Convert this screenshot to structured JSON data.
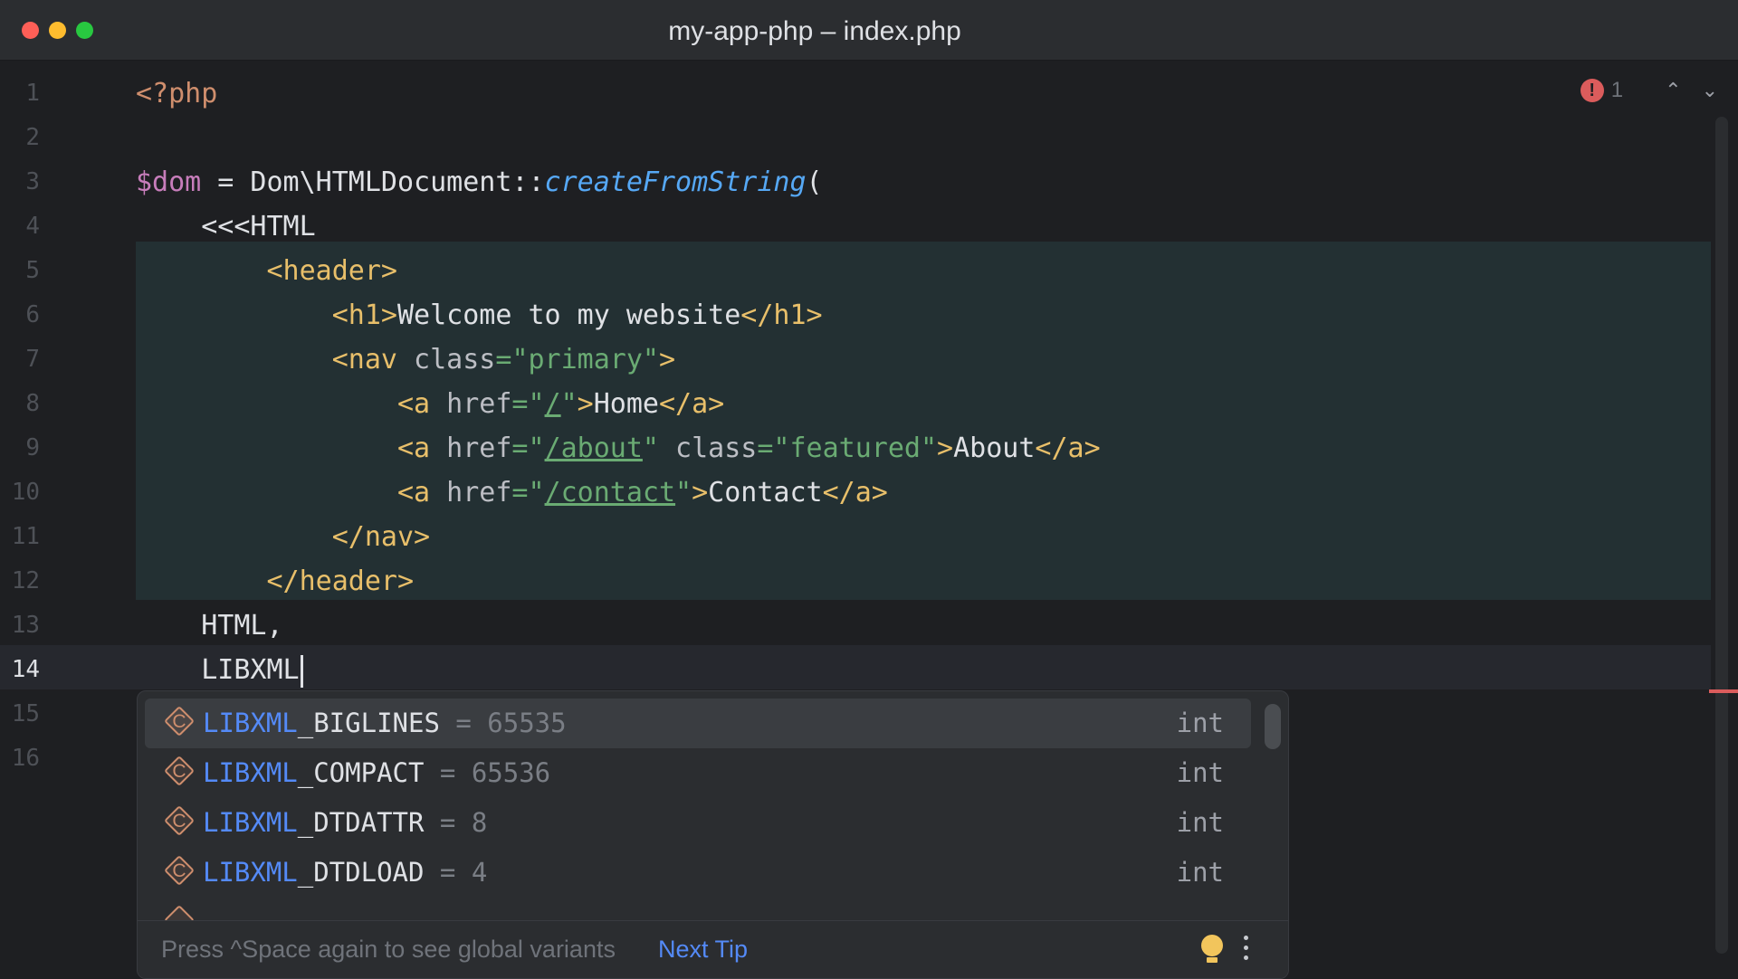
{
  "window": {
    "title": "my-app-php – index.php"
  },
  "inspections": {
    "error_count": "1",
    "error_glyph": "!",
    "up_glyph": "⌃",
    "down_glyph": "⌄"
  },
  "lines": [
    {
      "num": "1"
    },
    {
      "num": "2"
    },
    {
      "num": "3"
    },
    {
      "num": "4"
    },
    {
      "num": "5"
    },
    {
      "num": "6"
    },
    {
      "num": "7"
    },
    {
      "num": "8"
    },
    {
      "num": "9"
    },
    {
      "num": "10"
    },
    {
      "num": "11"
    },
    {
      "num": "12"
    },
    {
      "num": "13"
    },
    {
      "num": "14"
    },
    {
      "num": "15"
    },
    {
      "num": "16"
    }
  ],
  "code": {
    "l1": {
      "open": "<?php"
    },
    "l3": {
      "var": "$dom",
      "assign": " = Dom\\HTMLDocument::",
      "method": "createFromString",
      "paren": "("
    },
    "l4": {
      "text": "    <<<HTML"
    },
    "l5": {
      "indent": "        ",
      "tag": "<header>"
    },
    "l6": {
      "indent": "            ",
      "open": "<h1>",
      "text": "Welcome to my website",
      "close": "</h1>"
    },
    "l7": {
      "indent": "            ",
      "open": "<nav",
      "attr": " class",
      "eq": "=",
      "val": "\"primary\"",
      "end": ">"
    },
    "l8": {
      "indent": "                ",
      "open": "<a",
      "attr": " href",
      "eq": "=",
      "q1": "\"",
      "link": "/",
      "q2": "\"",
      "end": ">",
      "text": "Home",
      "close": "</a>"
    },
    "l9": {
      "indent": "                ",
      "open": "<a",
      "attr": " href",
      "eq": "=",
      "q1": "\"",
      "link": "/about",
      "q2": "\"",
      "attr2": " class",
      "eq2": "=",
      "val2": "\"featured\"",
      "end": ">",
      "text": "About",
      "close": "</a>"
    },
    "l10": {
      "indent": "                ",
      "open": "<a",
      "attr": " href",
      "eq": "=",
      "q1": "\"",
      "link": "/contact",
      "q2": "\"",
      "end": ">",
      "text": "Contact",
      "close": "</a>"
    },
    "l11": {
      "indent": "            ",
      "tag": "</nav>"
    },
    "l12": {
      "indent": "        ",
      "tag": "</header>"
    },
    "l13": {
      "text": "    HTML,"
    },
    "l14": {
      "text": "    LIBXML"
    }
  },
  "completion": {
    "items": [
      {
        "match": "LIBXML",
        "rest": "_BIGLINES",
        "eq": " = ",
        "value": "65535",
        "type": "int",
        "icon_letter": "C",
        "icon": "constant-icon"
      },
      {
        "match": "LIBXML",
        "rest": "_COMPACT",
        "eq": " = ",
        "value": "65536",
        "type": "int",
        "icon_letter": "C",
        "icon": "constant-icon"
      },
      {
        "match": "LIBXML",
        "rest": "_DTDATTR",
        "eq": " = ",
        "value": "8",
        "type": "int",
        "icon_letter": "C",
        "icon": "constant-icon"
      },
      {
        "match": "LIBXML",
        "rest": "_DTDLOAD",
        "eq": " = ",
        "value": "4",
        "type": "int",
        "icon_letter": "C",
        "icon": "constant-icon"
      }
    ],
    "tip": "Press ^Space again to see global variants",
    "next_tip": "Next Tip"
  },
  "colors": {
    "background": "#1e1f22",
    "highlight_block": "#233033",
    "accent": "#548af7",
    "error": "#db5c5c"
  }
}
